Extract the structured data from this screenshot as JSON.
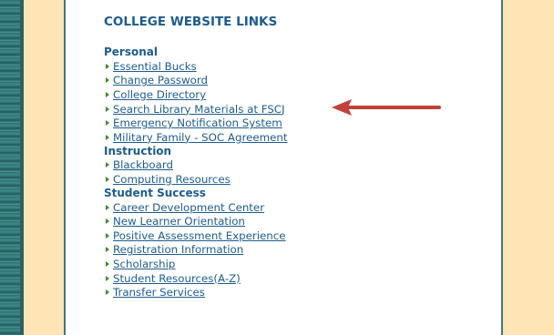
{
  "header": {
    "title": "COLLEGE WEBSITE LINKS"
  },
  "groups": [
    {
      "heading": "Personal",
      "links": [
        "Essential Bucks",
        "Change Password",
        "College Directory",
        "Search Library Materials at FSCJ",
        "Emergency Notification System",
        "Military Family - SOC Agreement"
      ]
    },
    {
      "heading": "Instruction",
      "links": [
        "Blackboard",
        "Computing Resources"
      ]
    },
    {
      "heading": "Student Success",
      "links": [
        "Career Development Center",
        "New Learner Orientation",
        "Positive Assessment Experience",
        "Registration Information",
        "Scholarship",
        "Student Resources(A-Z)",
        "Transfer Services"
      ]
    }
  ],
  "annotation": {
    "target_link": "Search Library Materials at FSCJ",
    "arrow_color": "#c0413a"
  },
  "colors": {
    "link": "#1d5c8e",
    "bullet": "#3e8a2a",
    "background": "#ffe4b5",
    "panel_border": "#3a7a7e"
  }
}
